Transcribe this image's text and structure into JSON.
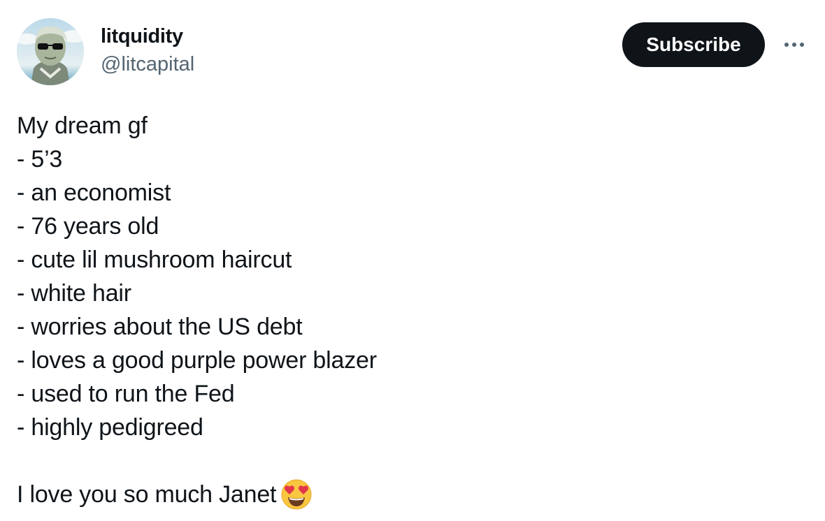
{
  "author": {
    "display_name": "litquidity",
    "handle": "@litcapital",
    "avatar_icon": "avatar-image"
  },
  "actions": {
    "subscribe_label": "Subscribe",
    "more_icon": "more-icon"
  },
  "tweet": {
    "lines": [
      "My dream gf",
      "- 5’3",
      "- an economist",
      "- 76 years old",
      "- cute lil mushroom haircut",
      "- white hair",
      "- worries about the US debt",
      "- loves a good purple power blazer",
      "- used to run the Fed",
      "- highly pedigreed"
    ],
    "closing": "I love you so much Janet",
    "closing_emoji": "heart-eyes-emoji-icon"
  },
  "colors": {
    "text": "#0f1419",
    "secondary_text": "#536471",
    "button_bg": "#0f1419",
    "button_text": "#ffffff"
  }
}
